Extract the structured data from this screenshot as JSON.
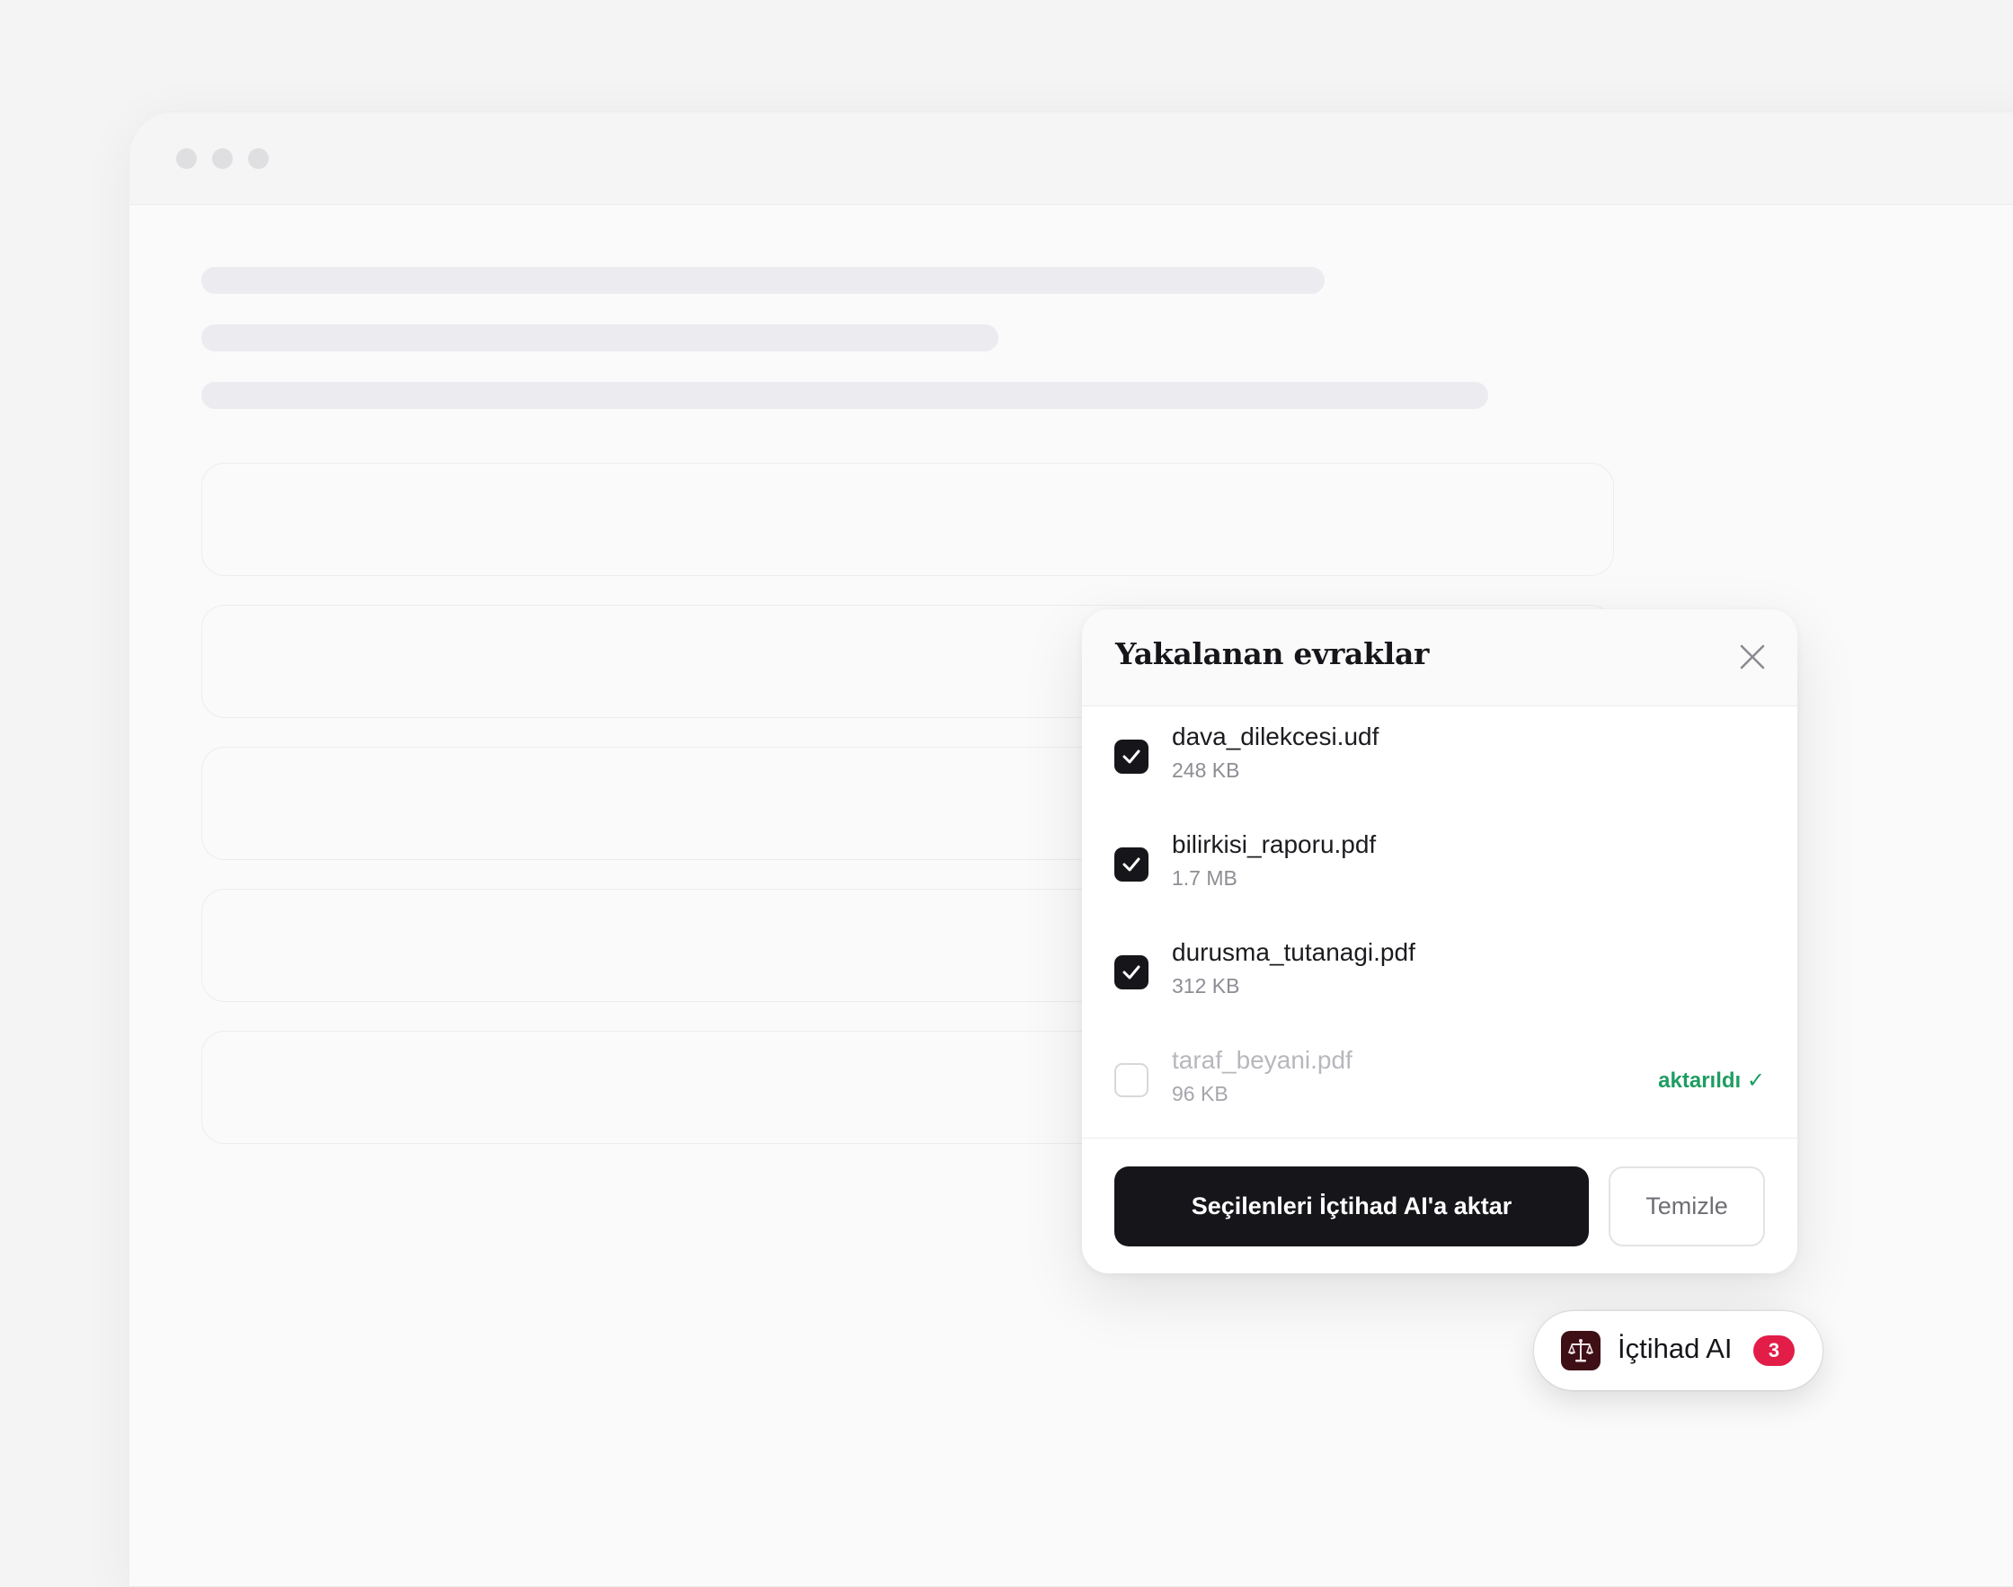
{
  "panel": {
    "title": "Yakalanan evraklar",
    "close_icon": "close-icon",
    "files": [
      {
        "name": "dava_dilekcesi.udf",
        "size": "248 KB",
        "checked": true,
        "status": ""
      },
      {
        "name": "bilirkisi_raporu.pdf",
        "size": "1.7 MB",
        "checked": true,
        "status": ""
      },
      {
        "name": "durusma_tutanagi.pdf",
        "size": "312 KB",
        "checked": true,
        "status": ""
      },
      {
        "name": "taraf_beyani.pdf",
        "size": "96 KB",
        "checked": false,
        "status": "aktarıldı ✓"
      }
    ],
    "primary_button": "Seçilenleri İçtihad AI'a aktar",
    "secondary_button": "Temizle"
  },
  "launcher": {
    "label": "İçtihad AI",
    "badge_count": "3",
    "logo_icon": "scales-of-justice-icon"
  },
  "colors": {
    "primary": "#16161a",
    "success": "#1f9d62",
    "badge": "#e11d48",
    "logo_bg": "#3f0f16"
  }
}
